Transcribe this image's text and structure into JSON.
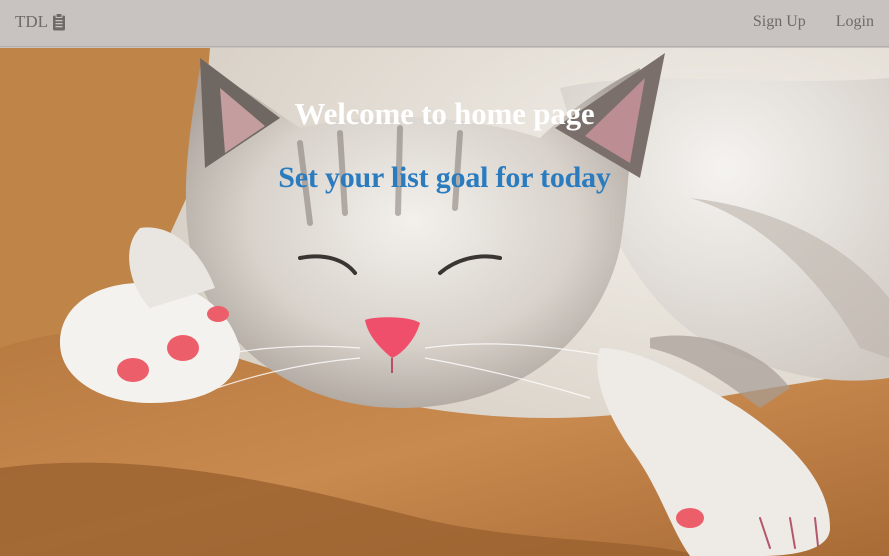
{
  "navbar": {
    "brand": "TDL",
    "brand_icon": "clipboard-icon",
    "links": [
      {
        "label": "Sign Up"
      },
      {
        "label": "Login"
      }
    ]
  },
  "hero": {
    "image": "sleeping-kitten-photo",
    "title": "Welcome to home page",
    "subtitle": "Set your list goal for today"
  },
  "colors": {
    "navbar_bg": "#c8c3c0",
    "nav_text": "#6f6a67",
    "title": "#ffffff",
    "subtitle": "#2b7bbf"
  }
}
